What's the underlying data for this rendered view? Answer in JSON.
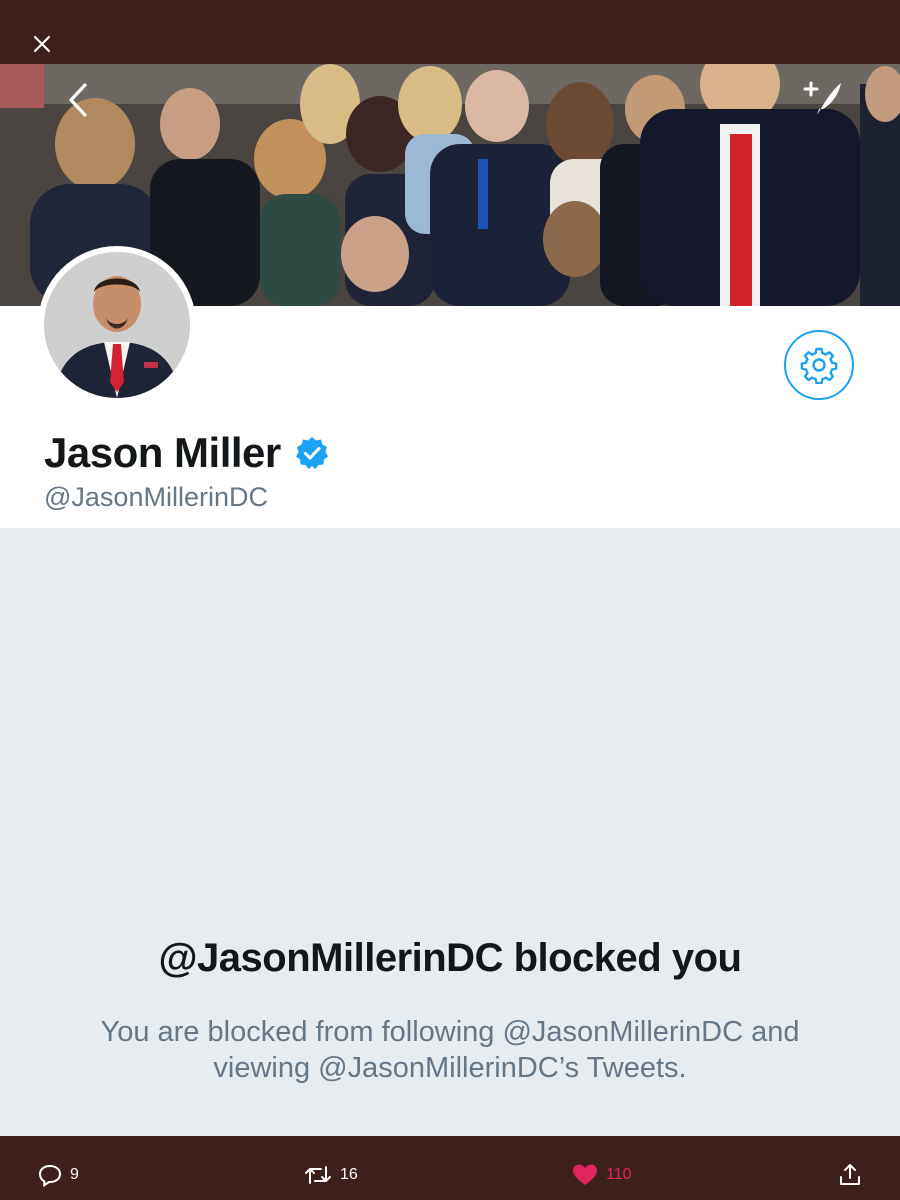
{
  "profile": {
    "display_name": "Jason Miller",
    "handle": "@JasonMillerinDC",
    "verified": true
  },
  "blocked": {
    "title": "@JasonMillerinDC blocked you",
    "message": "You are blocked from following @JasonMillerinDC and viewing @JasonMillerinDC’s Tweets."
  },
  "actions": {
    "reply_count": "9",
    "retweet_count": "16",
    "like_count": "110"
  },
  "icons": {
    "close": "close-icon",
    "back": "chevron-left-icon",
    "compose": "compose-tweet-icon",
    "settings": "gear-icon",
    "verified": "verified-badge-icon",
    "reply": "reply-icon",
    "retweet": "retweet-icon",
    "like": "heart-icon",
    "share": "share-icon"
  },
  "colors": {
    "accent": "#1da1f2",
    "like": "#e0245e",
    "bar": "#3d1f1c",
    "blocked_bg": "#e6ecf0"
  }
}
